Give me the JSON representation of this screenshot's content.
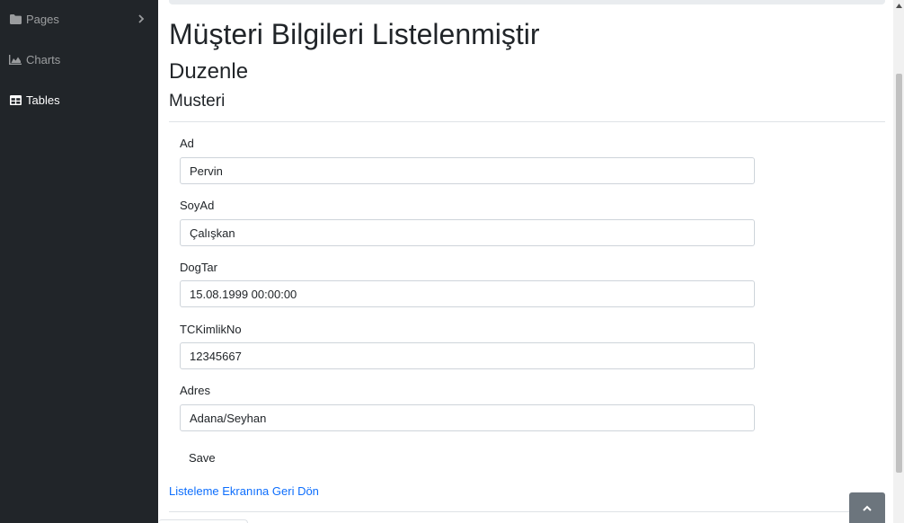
{
  "sidebar": {
    "items": [
      {
        "label": "Pages",
        "icon": "folder-icon"
      },
      {
        "label": "Charts",
        "icon": "chart-area-icon"
      },
      {
        "label": "Tables",
        "icon": "table-icon"
      }
    ]
  },
  "page": {
    "title": "Müşteri Bilgileri Listelenmiştir",
    "subtitle": "Duzenle",
    "section": "Musteri"
  },
  "form": {
    "fields": [
      {
        "label": "Ad",
        "value": "Pervin"
      },
      {
        "label": "SoyAd",
        "value": "Çalışkan"
      },
      {
        "label": "DogTar",
        "value": "15.08.1999 00:00:00"
      },
      {
        "label": "TCKimlikNo",
        "value": "12345667"
      },
      {
        "label": "Adres",
        "value": "Adana/Seyhan"
      }
    ],
    "save_label": "Save"
  },
  "back_link": "Listeleme Ekranına Geri Dön",
  "colors": {
    "sidebar_bg": "#212529",
    "link": "#0d6efd",
    "scroll_top_bg": "#6c757d"
  }
}
